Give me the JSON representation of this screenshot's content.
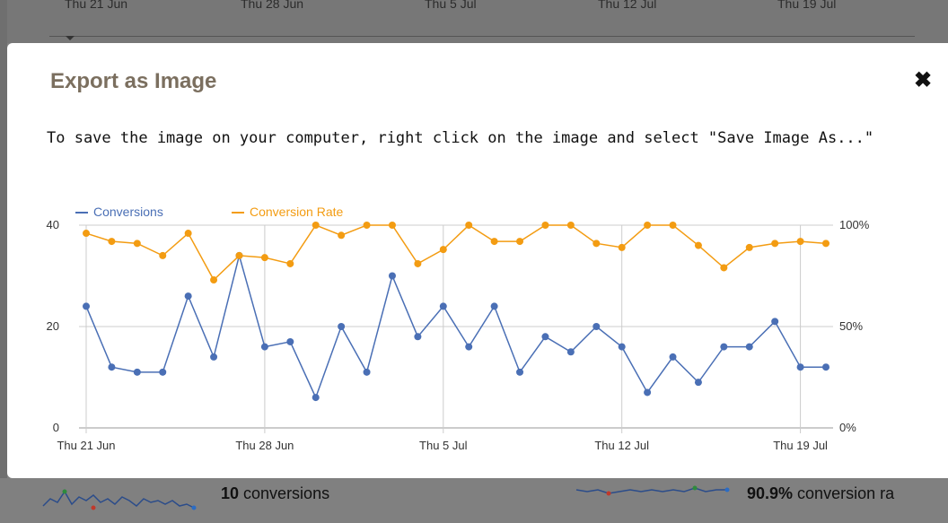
{
  "background": {
    "dates": [
      "Thu 21 Jun",
      "Thu 28 Jun",
      "Thu 5 Jul",
      "Thu 12 Jul",
      "Thu 19 Jul"
    ]
  },
  "dialog": {
    "title": "Export as Image",
    "close_icon": "close-icon",
    "instructions": "To save the image on your computer, right click on the image and select \"Save Image As...\""
  },
  "chart_data": {
    "type": "line",
    "legend": [
      "Conversions",
      "Conversion Rate"
    ],
    "x": [
      "Thu 21 Jun",
      "Fri 22 Jun",
      "Sat 23 Jun",
      "Sun 24 Jun",
      "Mon 25 Jun",
      "Tue 26 Jun",
      "Wed 27 Jun",
      "Thu 28 Jun",
      "Fri 29 Jun",
      "Sat 30 Jun",
      "Sun 1 Jul",
      "Mon 2 Jul",
      "Tue 3 Jul",
      "Wed 4 Jul",
      "Thu 5 Jul",
      "Fri 6 Jul",
      "Sat 7 Jul",
      "Sun 8 Jul",
      "Mon 9 Jul",
      "Tue 10 Jul",
      "Wed 11 Jul",
      "Thu 12 Jul",
      "Fri 13 Jul",
      "Sat 14 Jul",
      "Sun 15 Jul",
      "Mon 16 Jul",
      "Tue 17 Jul",
      "Wed 18 Jul",
      "Thu 19 Jul",
      "Fri 20 Jul"
    ],
    "x_tick_labels": [
      "Thu 21 Jun",
      "Thu 28 Jun",
      "Thu 5 Jul",
      "Thu 12 Jul",
      "Thu 19 Jul"
    ],
    "series": [
      {
        "name": "Conversions",
        "axis": "left",
        "color": "#4a6fb5",
        "values": [
          24,
          12,
          11,
          11,
          26,
          14,
          34,
          16,
          17,
          6,
          20,
          11,
          30,
          18,
          24,
          16,
          24,
          11,
          18,
          15,
          20,
          16,
          7,
          14,
          9,
          16,
          16,
          21,
          12,
          12
        ]
      },
      {
        "name": "Conversion Rate",
        "axis": "right",
        "color": "#f39c12",
        "values": [
          96,
          92,
          91,
          85,
          96,
          73,
          85,
          84,
          81,
          100,
          95,
          100,
          100,
          81,
          88,
          100,
          92,
          92,
          100,
          100,
          91,
          89,
          100,
          100,
          90,
          79,
          89,
          91,
          92,
          91
        ]
      }
    ],
    "y_left": {
      "ticks": [
        "0",
        "20",
        "40"
      ],
      "ylim": [
        0,
        40
      ]
    },
    "y_right": {
      "ticks": [
        "0%",
        "50%",
        "100%"
      ],
      "ylim": [
        0,
        100
      ]
    },
    "grid": true,
    "legend_position": "top-left"
  },
  "footer": {
    "left_value": "10",
    "left_label": " conversions",
    "right_value": "90.9%",
    "right_label": " conversion ra"
  }
}
